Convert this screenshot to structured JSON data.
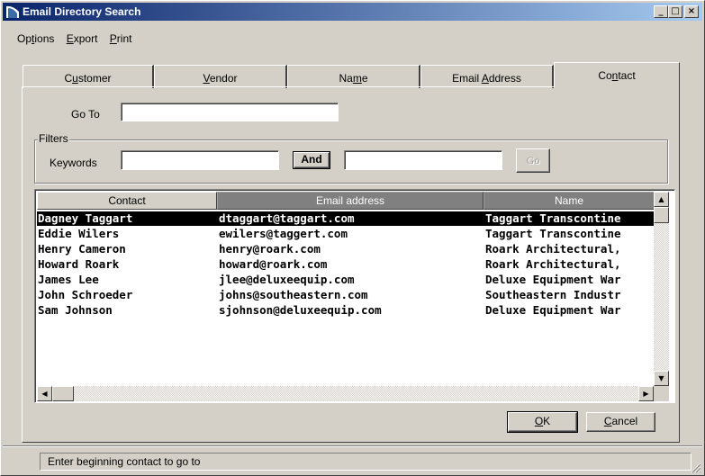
{
  "window": {
    "title": "Email Directory Search",
    "min_label": "_",
    "max_label": "□",
    "close_label": "×"
  },
  "menu": {
    "items": [
      {
        "pre": "Op",
        "key": "t",
        "post": "ions"
      },
      {
        "pre": "",
        "key": "E",
        "post": "xport"
      },
      {
        "pre": "",
        "key": "P",
        "post": "rint"
      }
    ]
  },
  "tabs": [
    {
      "pre": "C",
      "key": "u",
      "post": "stomer",
      "active": false
    },
    {
      "pre": "",
      "key": "V",
      "post": "endor",
      "active": false
    },
    {
      "pre": "Na",
      "key": "m",
      "post": "e",
      "active": false
    },
    {
      "pre": "Email ",
      "key": "A",
      "post": "ddress",
      "active": false
    },
    {
      "pre": "Co",
      "key": "n",
      "post": "tact",
      "active": true
    }
  ],
  "goto": {
    "label": "Go To",
    "value": ""
  },
  "filters": {
    "legend": "Filters",
    "keywords_label": "Keywords",
    "keyword1_value": "",
    "and_label": "And",
    "keyword2_value": "",
    "go_label": "Go"
  },
  "grid": {
    "columns": [
      "Contact",
      "Email address",
      "Name"
    ],
    "rows": [
      {
        "contact": "Dagney Taggart",
        "email": "dtaggart@taggart.com",
        "name": "Taggart Transcontine",
        "selected": true
      },
      {
        "contact": "Eddie Wilers",
        "email": "ewilers@taggert.com",
        "name": "Taggart Transcontine",
        "selected": false
      },
      {
        "contact": "Henry Cameron",
        "email": "henry@roark.com",
        "name": "Roark Architectural,",
        "selected": false
      },
      {
        "contact": "Howard Roark",
        "email": "howard@roark.com",
        "name": "Roark Architectural,",
        "selected": false
      },
      {
        "contact": "James Lee",
        "email": "jlee@deluxeequip.com",
        "name": "Deluxe Equipment War",
        "selected": false
      },
      {
        "contact": "John Schroeder",
        "email": "johns@southeastern.com",
        "name": "Southeastern Industr",
        "selected": false
      },
      {
        "contact": "Sam Johnson",
        "email": "sjohnson@deluxeequip.com",
        "name": "Deluxe Equipment War",
        "selected": false
      }
    ]
  },
  "buttons": {
    "ok_key": "O",
    "ok_post": "K",
    "cancel_key": "C",
    "cancel_post": "ancel"
  },
  "status": {
    "text": "Enter beginning contact to go to"
  },
  "colors": {
    "titlebar_start": "#0a246a",
    "titlebar_end": "#a6caf0",
    "face": "#d4d0c8",
    "selection": "#000000"
  }
}
